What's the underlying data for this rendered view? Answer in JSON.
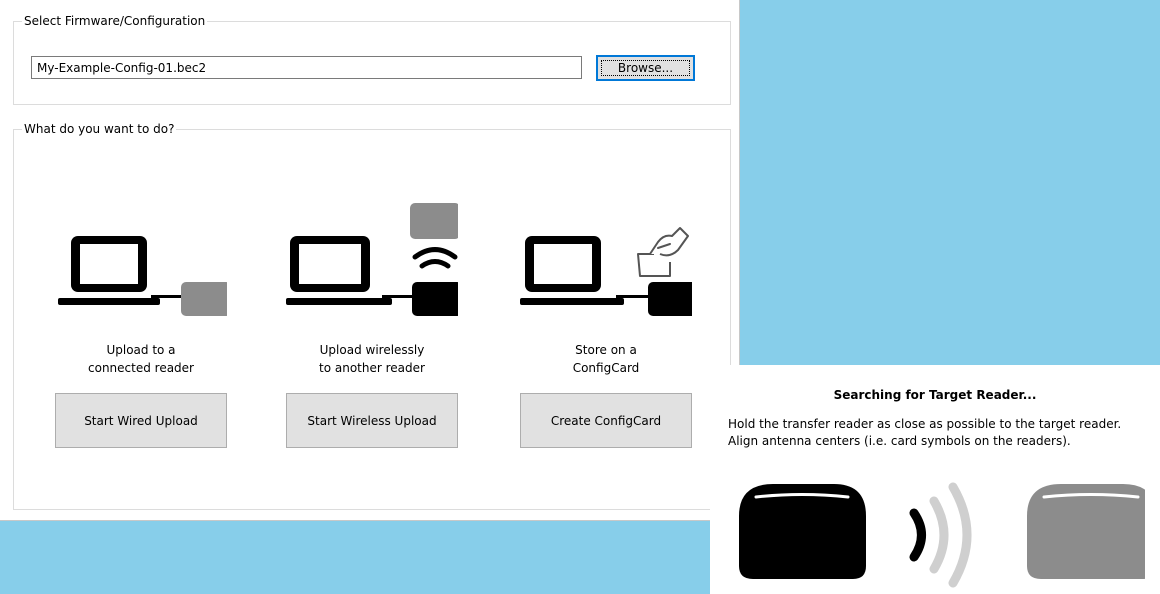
{
  "firmware_group": {
    "legend": "Select Firmware/Configuration",
    "file_value": "My-Example-Config-01.bec2",
    "browse_label": "Browse..."
  },
  "action_group": {
    "legend": "What do you want to do?",
    "options": [
      {
        "caption_line1": "Upload to a",
        "caption_line2": "connected reader",
        "button_label": "Start Wired Upload",
        "icon": "wired-upload-icon"
      },
      {
        "caption_line1": "Upload wirelessly",
        "caption_line2": "to another reader",
        "button_label": "Start Wireless Upload",
        "icon": "wireless-upload-icon"
      },
      {
        "caption_line1": "Store on a",
        "caption_line2": "ConfigCard",
        "button_label": "Create ConfigCard",
        "icon": "configcard-icon"
      }
    ]
  },
  "search_panel": {
    "title": "Searching for Target Reader...",
    "instruction_line1": "Hold the transfer reader as close as possible to the target reader.",
    "instruction_line2": "Align antenna centers (i.e. card symbols on the readers).",
    "graphic_icon": "reader-to-reader-transfer-icon"
  },
  "colors": {
    "desktop_background": "#87ceea",
    "window_background": "#ffffff",
    "button_face": "#e1e1e1",
    "focus_border": "#0078d7",
    "reader_gray": "#8c8c8c",
    "wave_gray": "#cfcfcf"
  }
}
